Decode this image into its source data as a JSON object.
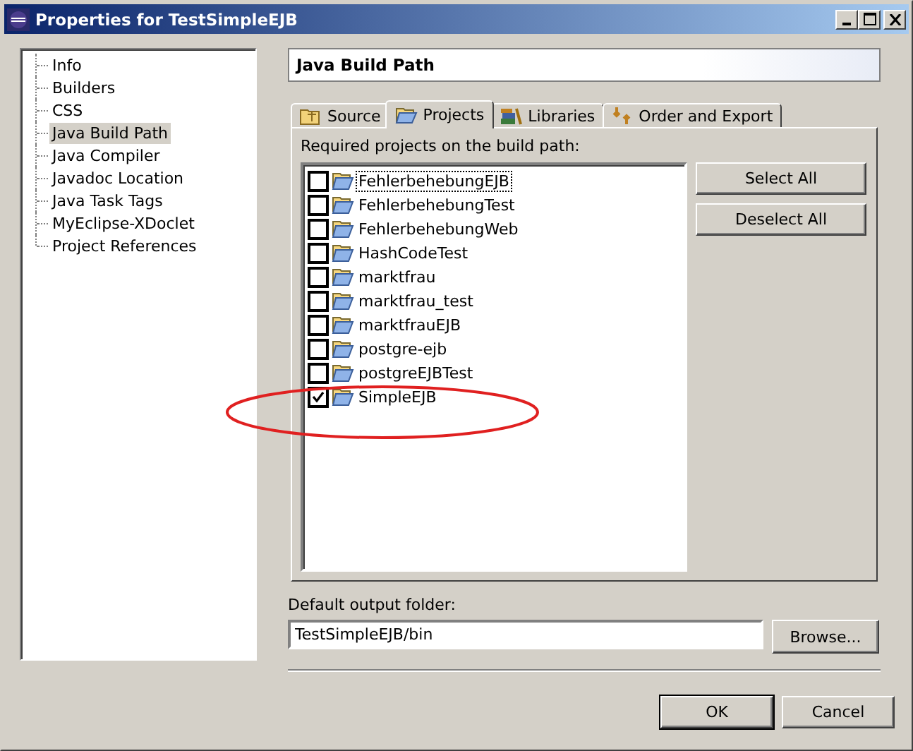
{
  "window": {
    "title": "Properties for TestSimpleEJB"
  },
  "sidebar": {
    "items": [
      {
        "label": "Info",
        "selected": false
      },
      {
        "label": "Builders",
        "selected": false
      },
      {
        "label": "CSS",
        "selected": false
      },
      {
        "label": "Java Build Path",
        "selected": true
      },
      {
        "label": "Java Compiler",
        "selected": false
      },
      {
        "label": "Javadoc Location",
        "selected": false
      },
      {
        "label": "Java Task Tags",
        "selected": false
      },
      {
        "label": "MyEclipse-XDoclet",
        "selected": false
      },
      {
        "label": "Project References",
        "selected": false
      }
    ]
  },
  "page_title": "Java Build Path",
  "tabs": [
    {
      "label": "Source",
      "kind": "source",
      "selected": false
    },
    {
      "label": "Projects",
      "kind": "projects",
      "selected": true
    },
    {
      "label": "Libraries",
      "kind": "libraries",
      "selected": false
    },
    {
      "label": "Order and Export",
      "kind": "order",
      "selected": false
    }
  ],
  "projects": {
    "label": "Required projects on the build path:",
    "items": [
      {
        "name": "FehlerbehebungEJB",
        "checked": false,
        "focused": true
      },
      {
        "name": "FehlerbehebungTest",
        "checked": false,
        "focused": false
      },
      {
        "name": "FehlerbehebungWeb",
        "checked": false,
        "focused": false
      },
      {
        "name": "HashCodeTest",
        "checked": false,
        "focused": false
      },
      {
        "name": "marktfrau",
        "checked": false,
        "focused": false
      },
      {
        "name": "marktfrau_test",
        "checked": false,
        "focused": false
      },
      {
        "name": "marktfrauEJB",
        "checked": false,
        "focused": false
      },
      {
        "name": "postgre-ejb",
        "checked": false,
        "focused": false
      },
      {
        "name": "postgreEJBTest",
        "checked": false,
        "focused": false
      },
      {
        "name": "SimpleEJB",
        "checked": true,
        "focused": false
      }
    ],
    "buttons": [
      "Select All",
      "Deselect All"
    ]
  },
  "output_folder": {
    "label": "Default output folder:",
    "value": "TestSimpleEJB/bin",
    "button": "Browse..."
  },
  "buttons": [
    "OK",
    "Cancel"
  ]
}
